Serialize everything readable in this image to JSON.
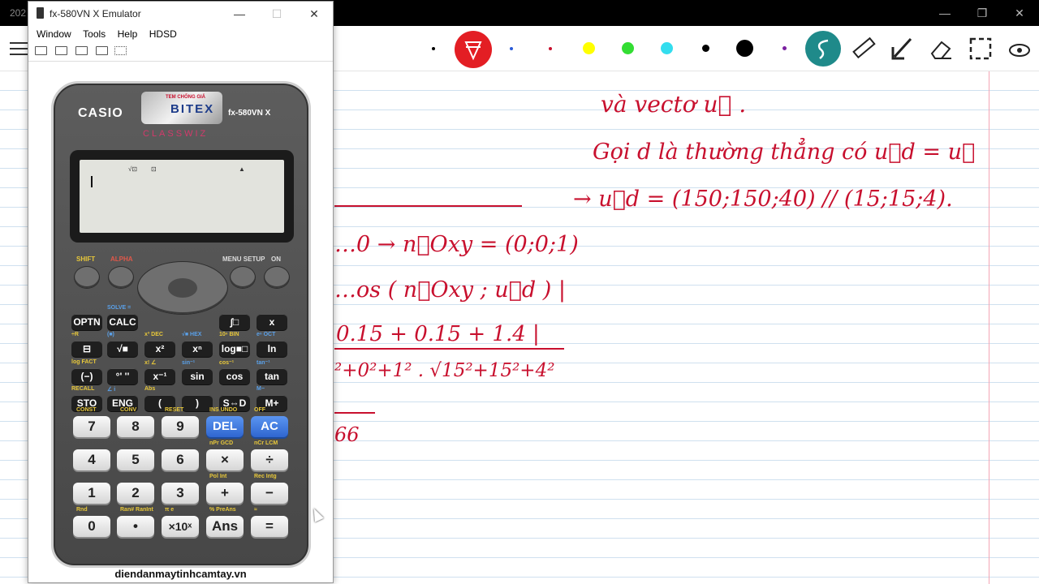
{
  "background_app": {
    "title_prefix": "202",
    "toolbar_colors": {
      "pen_active": "#e31e24",
      "yellow": "#ffff00",
      "green": "#33dd33",
      "cyan": "#33ddee",
      "black": "#000000",
      "teal_tool": "#1f8a8a"
    },
    "icons": [
      "menu-icon",
      "pen-icon",
      "lasso-icon",
      "ruler-icon",
      "arrow-icon",
      "eraser-icon",
      "select-icon",
      "eye-icon"
    ]
  },
  "handwriting": {
    "line1": "và vectơ u⃗ .",
    "line2": "Gọi d là thường thẳng có u⃗d = u⃗",
    "line3": "→ u⃗d = (150;150;40) // (15;15;4).",
    "line4": "…0 → n⃗Oxy = (0;0;1)",
    "line5": "…os ( n⃗Oxy ; u⃗d ) |",
    "line6": "0.15 + 0.15 + 1.4 |",
    "line7": "²+0²+1² . √15²+15²+4²",
    "line8": "66"
  },
  "emulator": {
    "title": "fx-580VN X Emulator",
    "menu": [
      "Window",
      "Tools",
      "Help",
      "HDSD"
    ],
    "toolbar_icons": [
      "screen-icon",
      "window-icon",
      "export-icon",
      "capture-icon",
      "grid-icon"
    ],
    "brand": "CASIO",
    "model": "fx-580VN X",
    "series": "CLASSWIZ",
    "sticker_top": "TEM CHỐNG GIẢ",
    "sticker_brand": "BITEX",
    "screen_indicators": [
      "√⊡",
      "⊡",
      "▲"
    ],
    "fn_labels": {
      "shift": "SHIFT",
      "alpha": "ALPHA",
      "menu": "MENU SETUP",
      "on": "ON"
    },
    "rows": [
      [
        {
          "sec": "",
          "label": "OPTN"
        },
        {
          "sec": "SOLVE =",
          "label": "CALC"
        },
        {
          "sec": "",
          "label": ""
        },
        {
          "sec": "",
          "label": ""
        },
        {
          "sec": "",
          "label": "∫□"
        },
        {
          "sec": "",
          "label": "x"
        }
      ],
      [
        {
          "sec": "÷R",
          "label": "⊟"
        },
        {
          "sec": "(■)",
          "label": "√■"
        },
        {
          "sec": "x³ DEC",
          "label": "x²"
        },
        {
          "sec": "√■ HEX",
          "label": "xⁿ"
        },
        {
          "sec": "10ⁿ BIN",
          "label": "log■□"
        },
        {
          "sec": "eⁿ OCT",
          "label": "ln"
        }
      ],
      [
        {
          "sec": "log FACT",
          "label": "(−)"
        },
        {
          "sec": "",
          "label": "°' ''"
        },
        {
          "sec": "x! ∠",
          "label": "x⁻¹"
        },
        {
          "sec": "sin⁻¹",
          "label": "sin"
        },
        {
          "sec": "cos⁻¹",
          "label": "cos"
        },
        {
          "sec": "tan⁻¹",
          "label": "tan"
        }
      ],
      [
        {
          "sec": "RECALL",
          "label": "STO"
        },
        {
          "sec": "∠ i",
          "label": "ENG"
        },
        {
          "sec": "Abs",
          "label": "("
        },
        {
          "sec": "",
          "label": ")"
        },
        {
          "sec": "",
          "label": "S⇔D"
        },
        {
          "sec": "M−",
          "label": "M+"
        }
      ]
    ],
    "num_rows": [
      {
        "top": [
          "CONST",
          "CONV",
          "RESET",
          "INS UNDO",
          "OFF"
        ],
        "keys": [
          "7",
          "8",
          "9",
          "DEL",
          "AC"
        ]
      },
      {
        "top": [
          "",
          "",
          "",
          "nPr GCD",
          "nCr LCM"
        ],
        "keys": [
          "4",
          "5",
          "6",
          "×",
          "÷"
        ]
      },
      {
        "top": [
          "",
          "",
          "",
          "Pol Int",
          "Rec Intg"
        ],
        "keys": [
          "1",
          "2",
          "3",
          "+",
          "−"
        ]
      },
      {
        "top": [
          "Rnd",
          "Ran# RanInt",
          "π e",
          "% PreAns",
          "≈"
        ],
        "keys": [
          "0",
          "•",
          "×10ˣ",
          "Ans",
          "="
        ]
      }
    ],
    "website": "diendanmaytinhcamtay.vn"
  }
}
